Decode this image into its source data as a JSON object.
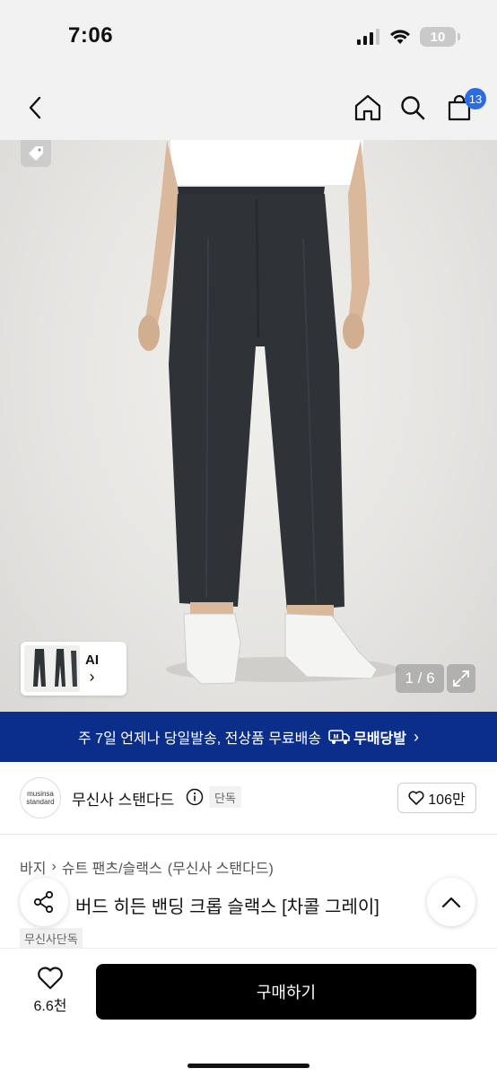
{
  "status_bar": {
    "time": "7:06",
    "battery": "10"
  },
  "nav": {
    "cart_count": "13"
  },
  "gallery": {
    "counter": "1 / 6",
    "ai_label": "AI",
    "ai_chevron": "›"
  },
  "promo": {
    "text": "주 7일 언제나 당일발송, 전상품 무료배송",
    "badge": "무배당발",
    "chevron": "›"
  },
  "brand": {
    "logo_line1": "musinsa",
    "logo_line2": "standard",
    "name": "무신사 스탠다드",
    "exclusive_chip": "단독",
    "likes": "106만"
  },
  "breadcrumb": {
    "items": [
      "바지",
      "슈트 팬츠/슬랙스",
      "(무신사 스탠다드)"
    ],
    "separator": "›"
  },
  "product": {
    "title": "버드 히든 밴딩 크롭 슬랙스 [차콜 그레이]",
    "exclusive_tag": "무신사단독"
  },
  "bottom": {
    "wish_count": "6.6천",
    "buy_label": "구매하기"
  },
  "colors": {
    "promo_bg": "#0a2e8a",
    "badge_blue": "#2b6be6",
    "buy_bg": "#000000"
  }
}
